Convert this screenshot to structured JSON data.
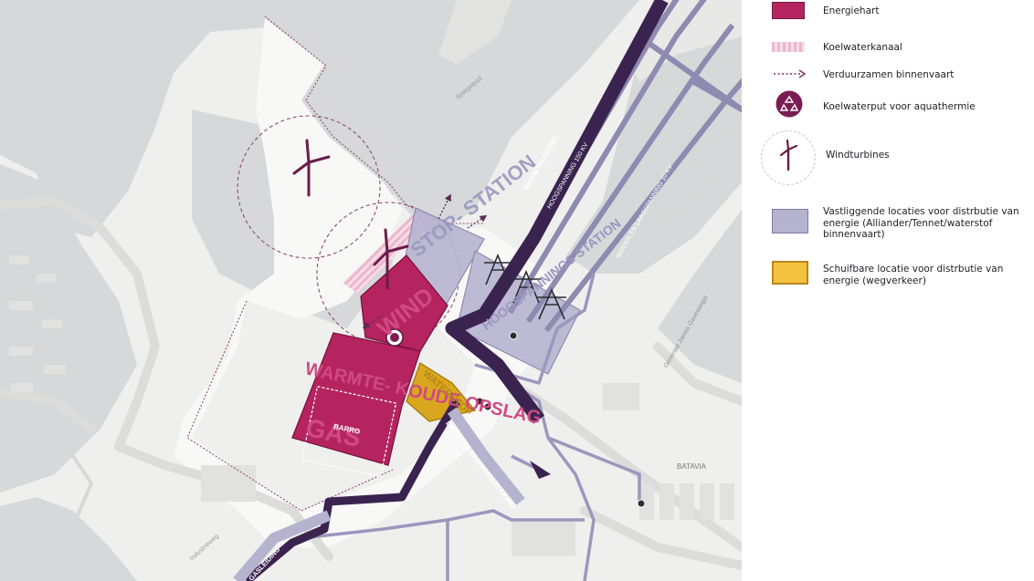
{
  "map": {
    "zones": {
      "stopstation": "STOP- STATION",
      "wind": "WIND",
      "warmte_koude_opslag": "WARMTE- KOUDE OPSLAG",
      "gas": "GAS",
      "barro": "BARRO",
      "waterstof": "WATERSTOF",
      "hoogspanningsstation": "HOOGSPANNINGS STATION"
    },
    "lines": {
      "warmteleiding": "WARMTELEIDING",
      "hoogspanning": "HOOGSPANNING 150 KV",
      "middenspanning": "MIDDEN EN LAAGSPANNING 10 KV",
      "drinkwater": "DRINK- EN BRONWATERLEIDING",
      "gasleiding": "GASLEIDING"
    },
    "place_labels": {
      "batavia": "BATAVIA",
      "spiegelpad": "Spiegelpad",
      "james_cavingdorf": "Generaal James Gavinsingel",
      "industrieweg": "Industrieweg"
    },
    "colors": {
      "energiehart": "#b5245f",
      "distribution": "#b6b3cf",
      "wegverkeer": "#d9a61f",
      "warmteleiding": "#3b2350",
      "water": "#d6d8d9"
    }
  },
  "legend": {
    "items": [
      {
        "label": "Energiehart",
        "icon": "energiehart-swatch"
      },
      {
        "label": "Koelwaterkanaal",
        "icon": "koelwaterkanaal-swatch"
      },
      {
        "label": "Verduurzamen binnenvaart",
        "icon": "dotted-arrow-icon"
      },
      {
        "label": "Koelwaterput voor aquathermie",
        "icon": "recycle-circle-icon"
      },
      {
        "label": "Windturbines",
        "icon": "wind-turbine-icon"
      },
      {
        "label": "Vastliggende locaties voor distrbutie van energie (Alliander/Tennet/waterstof binnenvaart)",
        "icon": "distribution-swatch"
      },
      {
        "label": "Schuifbare locatie voor distrbutie van energie (wegverkeer)",
        "icon": "wegverkeer-swatch"
      }
    ]
  }
}
